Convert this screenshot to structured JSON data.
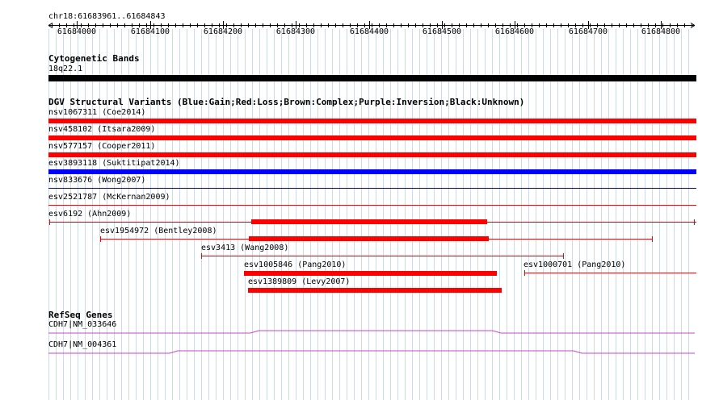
{
  "ruler": {
    "region_label": "chr18:61683961..61684843",
    "ticks": [
      "61684000",
      "61684100",
      "61684200",
      "61684300",
      "61684400",
      "61684500",
      "61684600",
      "61684700",
      "61684800"
    ]
  },
  "cytogenetic": {
    "title": "Cytogenetic Bands",
    "band_label": "18q22.1",
    "band_color": "#000000"
  },
  "dgv": {
    "title": "DGV Structural Variants (Blue:Gain;Red:Loss;Brown:Complex;Purple:Inversion;Black:Unknown)",
    "colors": {
      "gain": "#0000ff",
      "loss": "#ff0000"
    },
    "tracks": [
      {
        "label": "nsv1067311 (Coe2014)"
      },
      {
        "label": "nsv458102 (Itsara2009)"
      },
      {
        "label": "nsv577157 (Cooper2011)"
      },
      {
        "label": "esv3893118 (Suktitipat2014)"
      },
      {
        "label": "nsv833676 (Wong2007)"
      },
      {
        "label": "esv2521787 (McKernan2009)"
      },
      {
        "label": "esv6192 (Ahn2009)"
      },
      {
        "label": "esv1954972 (Bentley2008)"
      },
      {
        "label": "esv3413 (Wang2008)"
      },
      {
        "label": "esv1005846 (Pang2010)"
      },
      {
        "label": "esv1000701 (Pang2010)"
      },
      {
        "label": "esv1389809 (Levy2007)"
      }
    ]
  },
  "refseq": {
    "title": "RefSeq Genes",
    "color": "#cc44cc",
    "genes": [
      {
        "label": "CDH7|NM_033646"
      },
      {
        "label": "CDH7|NM_004361"
      }
    ]
  }
}
